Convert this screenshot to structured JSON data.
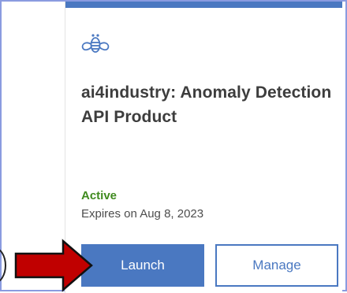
{
  "product": {
    "logo_icon": "bee-icon",
    "title": "ai4industry: Anomaly Detection API Product",
    "status": "Active",
    "expires": "Expires on Aug 8, 2023"
  },
  "actions": {
    "launch_label": "Launch",
    "manage_label": "Manage"
  },
  "annotation": {
    "arrow_icon": "red-arrow-icon"
  },
  "colors": {
    "accent": "#4a78c1",
    "status_active": "#3f8a1e",
    "arrow_red": "#c00000",
    "frame_border": "#8a9be0"
  }
}
